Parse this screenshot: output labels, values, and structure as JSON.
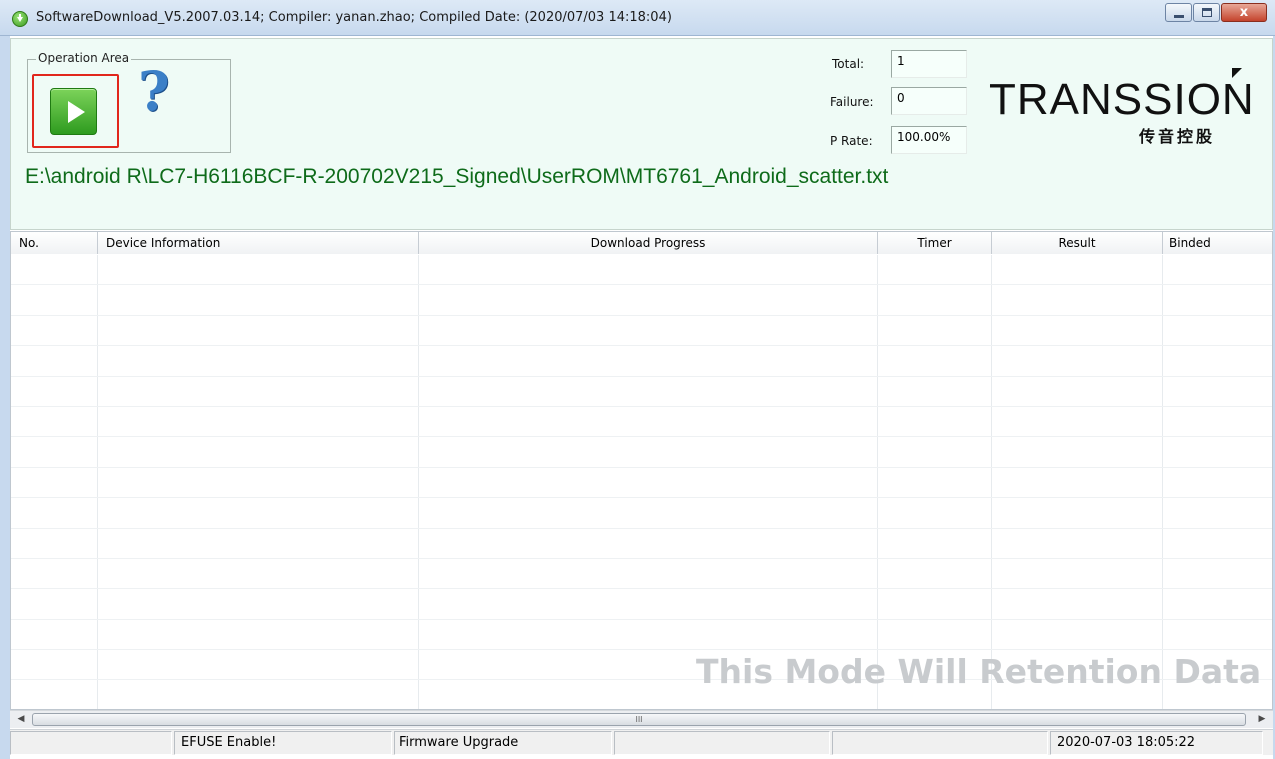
{
  "window": {
    "title": "SoftwareDownload_V5.2007.03.14; Compiler: yanan.zhao; Compiled Date: (2020/07/03 14:18:04)",
    "close_glyph": "x"
  },
  "operation_area": {
    "legend": "Operation Area",
    "help_glyph": "?"
  },
  "stats": {
    "total_label": "Total:",
    "total_value": "1",
    "failure_label": "Failure:",
    "failure_value": "0",
    "prate_label": "P Rate:",
    "prate_value": "100.00%"
  },
  "brand": {
    "name": "TRANSSION",
    "subtitle": "传音控股"
  },
  "scatter_path": "E:\\android R\\LC7-H6116BCF-R-200702V215_Signed\\UserROM\\MT6761_Android_scatter.txt",
  "table": {
    "columns": [
      "No.",
      "Device Information",
      "Download Progress",
      "Timer",
      "Result",
      "Binded"
    ],
    "watermark": "This Mode Will Retention Data"
  },
  "scrollbar": {
    "grip": "III"
  },
  "statusbar": {
    "cells": [
      "",
      "EFUSE Enable!",
      "Firmware Upgrade",
      "",
      "",
      "2020-07-03 18:05:22"
    ]
  },
  "colors": {
    "panel_bg": "#effbf6",
    "path_text": "#0e6b1a",
    "highlight_border": "#e1261c",
    "play_green": "#2e9b1f"
  },
  "icons": [
    "download-app-icon",
    "play-icon",
    "help-icon",
    "minimize-icon",
    "maximize-icon",
    "close-icon"
  ]
}
